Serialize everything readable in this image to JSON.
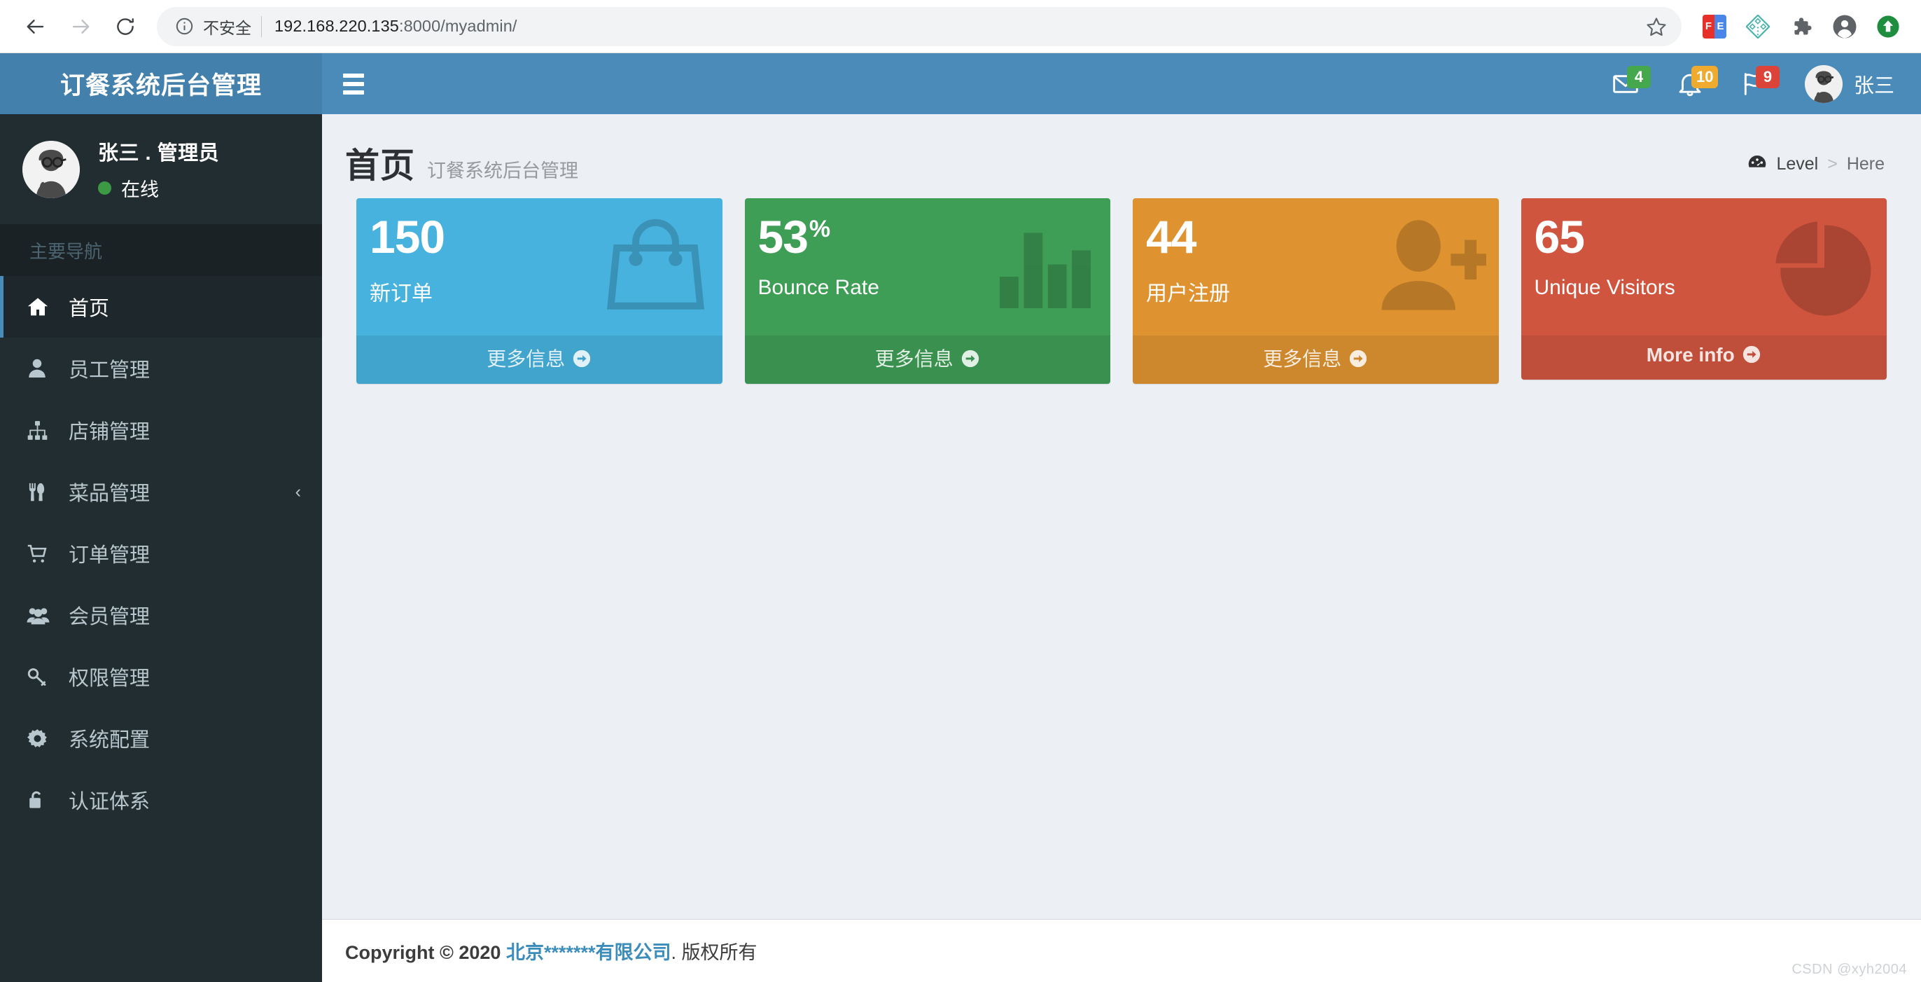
{
  "browser": {
    "back_label": "Back",
    "forward_label": "Forward",
    "reload_label": "Reload",
    "security_label": "不安全",
    "url_host": "192.168.220.135",
    "url_path": ":8000/myadmin/",
    "bookmark_label": "Bookmark this tab",
    "extensions": [
      {
        "name": "fe-extension-icon",
        "label": "FE"
      },
      {
        "name": "qrcode-extension-icon",
        "label": "QR"
      },
      {
        "name": "puzzle-extensions-icon",
        "label": "Extensions"
      },
      {
        "name": "profile-avatar-icon",
        "label": "Profile"
      },
      {
        "name": "update-browser-icon",
        "label": "Update"
      }
    ]
  },
  "navbar": {
    "logo": "订餐系统后台管理",
    "toggle_label": "切换侧边栏",
    "messages": {
      "icon": "envelope-icon",
      "badge": "4",
      "badge_color": "#46a84d"
    },
    "notifications": {
      "icon": "bell-icon",
      "badge": "10",
      "badge_color": "#eeab2f"
    },
    "tasks": {
      "icon": "flag-icon",
      "badge": "9",
      "badge_color": "#dc4439"
    },
    "user": {
      "name": "张三",
      "avatar": "user-avatar"
    }
  },
  "sidebar": {
    "user_panel": {
      "name": "张三 . 管理员",
      "status": "在线",
      "status_color": "#3c9a45"
    },
    "menu_header": "主要导航",
    "items": [
      {
        "label": "首页",
        "icon": "home-icon",
        "active": true,
        "arrow": ""
      },
      {
        "label": "员工管理",
        "icon": "user-icon",
        "active": false,
        "arrow": ""
      },
      {
        "label": "店铺管理",
        "icon": "sitemap-icon",
        "active": false,
        "arrow": ""
      },
      {
        "label": "菜品管理",
        "icon": "cutlery-icon",
        "active": false,
        "arrow": "‹"
      },
      {
        "label": "订单管理",
        "icon": "cart-icon",
        "active": false,
        "arrow": ""
      },
      {
        "label": "会员管理",
        "icon": "users-icon",
        "active": false,
        "arrow": ""
      },
      {
        "label": "权限管理",
        "icon": "key-icon",
        "active": false,
        "arrow": ""
      },
      {
        "label": "系统配置",
        "icon": "gear-icon",
        "active": false,
        "arrow": ""
      },
      {
        "label": "认证体系",
        "icon": "lock-icon",
        "active": false,
        "arrow": ""
      }
    ]
  },
  "content": {
    "title": "首页",
    "subtitle": "订餐系统后台管理",
    "breadcrumb": {
      "icon": "dashboard-icon",
      "items": [
        "Level",
        "Here"
      ],
      "separator": ">"
    },
    "boxes": [
      {
        "number": "150",
        "suffix": "",
        "text": "新订单",
        "footer": "更多信息",
        "footer_en": false,
        "color": "#47b2de",
        "theme": "box-blue",
        "icon": "shopping-bag-icon"
      },
      {
        "number": "53",
        "suffix": "%",
        "text": "Bounce Rate",
        "footer": "更多信息",
        "footer_en": false,
        "color": "#3f9e56",
        "theme": "box-green",
        "icon": "bar-chart-icon"
      },
      {
        "number": "44",
        "suffix": "",
        "text": "用户注册",
        "footer": "更多信息",
        "footer_en": false,
        "color": "#df9330",
        "theme": "box-yellow",
        "icon": "user-plus-icon"
      },
      {
        "number": "65",
        "suffix": "",
        "text": "Unique Visitors",
        "footer": "More info",
        "footer_en": true,
        "color": "#d0553f",
        "theme": "box-red",
        "icon": "pie-chart-icon"
      }
    ]
  },
  "footer": {
    "prefix": "Copyright © 2020 ",
    "company": "北京*******有限公司",
    "suffix": ". 版权所有",
    "watermark": "CSDN @xyh2004"
  }
}
